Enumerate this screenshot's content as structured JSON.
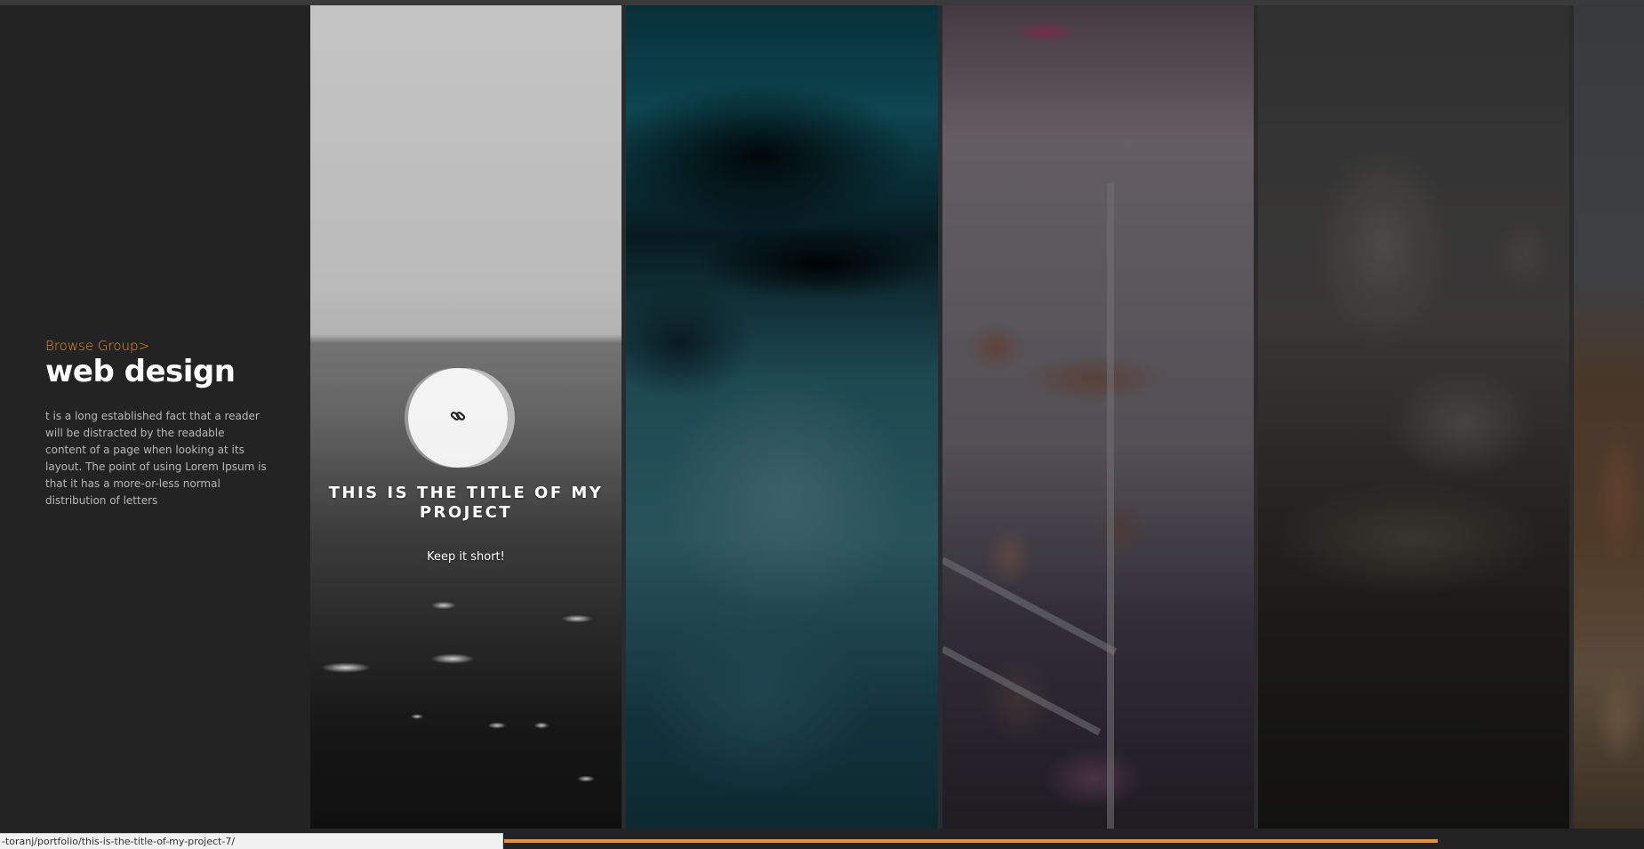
{
  "sidebar": {
    "browse_label": "Browse Group>",
    "group_title": "web design",
    "description": "t is a long established fact that a reader will be distracted by the readable content of a page when looking at its layout. The point of using Lorem Ipsum is that it has a more-or-less normal distribution of letters"
  },
  "gallery": {
    "panels": [
      {
        "image": "black-and-white beach"
      },
      {
        "image": "teal underwater figure"
      },
      {
        "image": "subway passengers"
      },
      {
        "image": "woman sitting on hay bale"
      },
      {
        "image": "stacked logs in fog"
      }
    ],
    "active_project": {
      "title": "THIS IS THE TITLE OF MY PROJECT",
      "subtitle": "Keep it short!",
      "icon": "link-icon"
    }
  },
  "status_bar": {
    "url": "-toranj/portfolio/this-is-the-title-of-my-project-7/"
  },
  "colors": {
    "accent": "#e8912d",
    "background": "#232323"
  }
}
